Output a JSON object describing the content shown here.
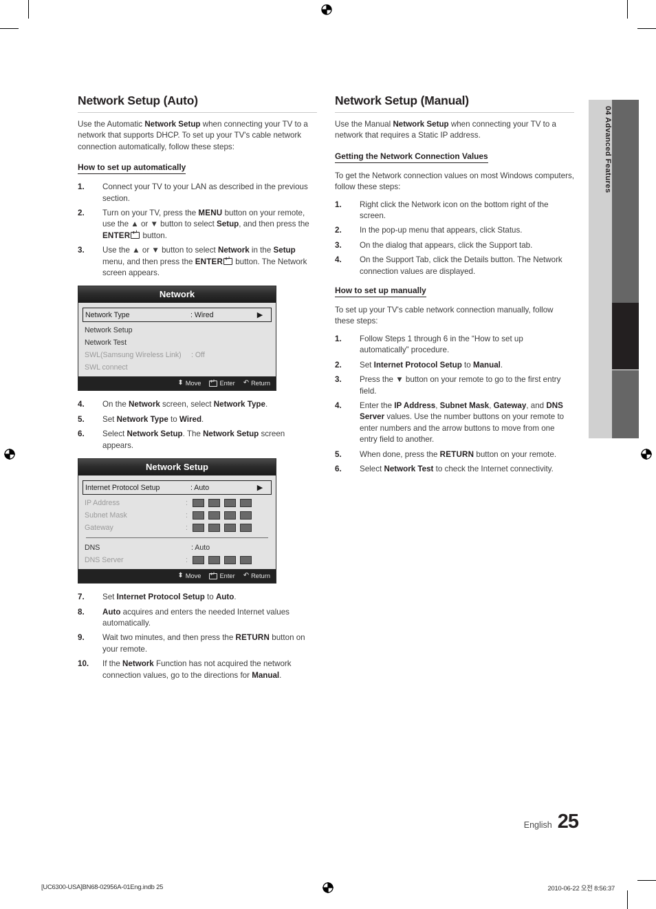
{
  "page": {
    "number": "25",
    "language_label": "English",
    "chapter_tab": "04  Advanced Features"
  },
  "left_column": {
    "title": "Network Setup (Auto)",
    "intro": "Use the Automatic <b>Network Setup</b> when connecting your TV to a network that supports DHCP. To set up your TV's cable network connection automatically, follow these steps:",
    "subhead": "How to set up automatically",
    "steps_1_3": [
      {
        "num": "1.",
        "html": "Connect your TV to your LAN as described in the previous section."
      },
      {
        "num": "2.",
        "html": "Turn on your TV, press the <span class=\"kcap\">MENU</span> button on your remote, use the ▲ or ▼ button to select <b>Setup</b>, and then press the <span class=\"kcap\">ENTER</span><span class=\"enter-key\"></span> button."
      },
      {
        "num": "3.",
        "html": "Use the ▲ or ▼ button to select <b>Network</b> in the <b>Setup</b> menu, and then press the <span class=\"kcap\">ENTER</span><span class=\"enter-key\"></span> button. The Network screen appears."
      }
    ],
    "steps_4_6": [
      {
        "num": "4.",
        "html": "On the <b>Network</b> screen, select <b>Network Type</b>."
      },
      {
        "num": "5.",
        "html": "Set <b>Network Type</b> to <b>Wired</b>."
      },
      {
        "num": "6.",
        "html": "Select <b>Network Setup</b>. The <b>Network Setup</b> screen appears."
      }
    ],
    "steps_7_10": [
      {
        "num": "7.",
        "html": "Set <b>Internet Protocol Setup</b> to <b>Auto</b>."
      },
      {
        "num": "8.",
        "html": "<b>Auto</b> acquires and enters the needed Internet values automatically."
      },
      {
        "num": "9.",
        "html": "Wait two minutes, and then press the <span class=\"kcap\">RETURN</span> button on your remote."
      },
      {
        "num": "10.",
        "html": "If the <b>Network</b> Function has not acquired the network connection values, go to the directions for <b>Manual</b>."
      }
    ]
  },
  "right_column": {
    "title": "Network Setup (Manual)",
    "intro": "Use the Manual <b>Network Setup</b> when connecting your TV to a network that requires a Static IP address.",
    "subhead_values": "Getting the Network Connection Values",
    "values_intro": "To get the Network connection values on most Windows computers, follow these steps:",
    "values_steps": [
      {
        "num": "1.",
        "html": "Right click the Network icon on the bottom right of the screen."
      },
      {
        "num": "2.",
        "html": "In the pop-up menu that appears, click Status."
      },
      {
        "num": "3.",
        "html": "On the dialog that appears, click the Support tab."
      },
      {
        "num": "4.",
        "html": "On the Support Tab, click the Details button. The Network connection values are displayed."
      }
    ],
    "subhead_manual": "How to set up manually",
    "manual_intro": "To set up your TV's cable network connection manually, follow these steps:",
    "manual_steps": [
      {
        "num": "1.",
        "html": "Follow Steps 1 through 6 in the “How to set up automatically” procedure."
      },
      {
        "num": "2.",
        "html": "Set <b>Internet Protocol Setup</b> to <b>Manual</b>."
      },
      {
        "num": "3.",
        "html": "Press the ▼ button on your remote to go to the first entry field."
      },
      {
        "num": "4.",
        "html": "Enter the <b>IP Address</b>, <b>Subnet Mask</b>, <b>Gateway</b>, and <b>DNS Server</b> values. Use the number buttons on your remote to enter numbers and the arrow buttons to move from one entry field to another."
      },
      {
        "num": "5.",
        "html": "When done, press the <span class=\"kcap\">RETURN</span> button on your remote."
      },
      {
        "num": "6.",
        "html": "Select <b>Network Test</b> to check the Internet connectivity."
      }
    ]
  },
  "osd_network": {
    "title": "Network",
    "rows": [
      {
        "label": "Network Type",
        "value": ": Wired",
        "arrow": "▶",
        "state": "highlight"
      },
      {
        "label": "Network Setup",
        "value": "",
        "arrow": "",
        "state": "normal"
      },
      {
        "label": "Network Test",
        "value": "",
        "arrow": "",
        "state": "normal"
      },
      {
        "label": "SWL(Samsung Wireless Link)",
        "value": ": Off",
        "arrow": "",
        "state": "dim"
      },
      {
        "label": "SWL connect",
        "value": "",
        "arrow": "",
        "state": "dim"
      }
    ],
    "footer": [
      {
        "icon": "updown-arrow-icon",
        "label": "Move"
      },
      {
        "icon": "enter-key-icon",
        "label": "Enter"
      },
      {
        "icon": "return-arrow-icon",
        "label": "Return"
      }
    ]
  },
  "osd_network_setup": {
    "title": "Network Setup",
    "rows": [
      {
        "label": "Internet Protocol Setup",
        "value": ": Auto",
        "arrow": "▶",
        "state": "highlight",
        "kind": "text"
      },
      {
        "label": "IP Address",
        "value": ":",
        "state": "dim",
        "kind": "boxes",
        "boxes": 4
      },
      {
        "label": "Subnet Mask",
        "value": ":",
        "state": "dim",
        "kind": "boxes",
        "boxes": 4
      },
      {
        "label": "Gateway",
        "value": ":",
        "state": "dim",
        "kind": "boxes",
        "boxes": 4
      },
      {
        "label": "DNS",
        "value": ": Auto",
        "state": "normal",
        "kind": "text",
        "separator_before": true
      },
      {
        "label": "DNS Server",
        "value": ":",
        "state": "dim",
        "kind": "boxes",
        "boxes": 4
      }
    ],
    "footer": [
      {
        "icon": "updown-arrow-icon",
        "label": "Move"
      },
      {
        "icon": "enter-key-icon",
        "label": "Enter"
      },
      {
        "icon": "return-arrow-icon",
        "label": "Return"
      }
    ]
  },
  "print_footer": {
    "left": "[UC6300-USA]BN68-02956A-01Eng.indb   25",
    "right": "2010-06-22   오전 8:56:37"
  }
}
